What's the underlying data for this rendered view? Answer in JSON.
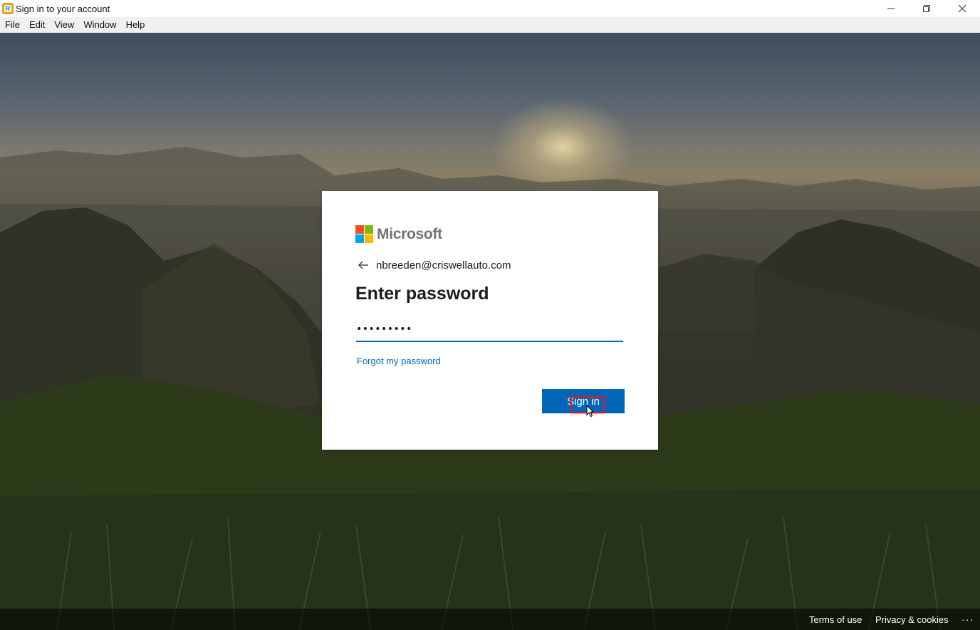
{
  "window": {
    "title": "Sign in to your account",
    "app_icon_letter": "R"
  },
  "menu": {
    "items": [
      "File",
      "Edit",
      "View",
      "Window",
      "Help"
    ]
  },
  "card": {
    "logo_text": "Microsoft",
    "logo_colors": [
      "#f25022",
      "#7fba00",
      "#00a4ef",
      "#ffb900"
    ],
    "identity": "nbreeden@criswellauto.com",
    "heading": "Enter password",
    "password_masked": "•••••••••",
    "forgot_label": "Forgot my password",
    "signin_label": "Sign in",
    "accent_color": "#0067b8"
  },
  "footer": {
    "terms": "Terms of use",
    "privacy": "Privacy & cookies",
    "more": "..."
  }
}
